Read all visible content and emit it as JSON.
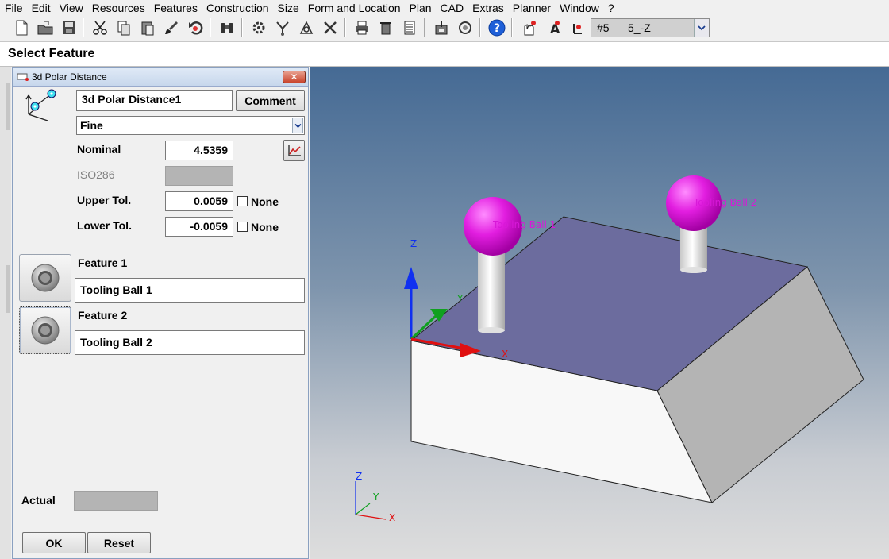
{
  "menu": [
    "File",
    "Edit",
    "View",
    "Resources",
    "Features",
    "Construction",
    "Size",
    "Form and Location",
    "Plan",
    "CAD",
    "Extras",
    "Planner",
    "Window",
    "?"
  ],
  "toolbar": {
    "icons": [
      "new-file-icon",
      "open-folder-icon",
      "save-icon",
      "cut-icon",
      "copy-icon",
      "paste-icon",
      "brush-icon",
      "undo-icon",
      "binoculars-icon",
      "probe-settings-icon",
      "stylus-icon",
      "coordinate-icon",
      "tools-icon",
      "print-icon",
      "delete-icon",
      "list-icon",
      "measure-icon",
      "refresh-icon",
      "help-icon",
      "touch-icon",
      "text-icon",
      "axis-icon"
    ],
    "combo_number": "#5",
    "combo_value": "5_-Z"
  },
  "status": {
    "title": "Select Feature"
  },
  "dialog": {
    "title": "3d Polar Distance",
    "close_label": "✕",
    "name_value": "3d Polar Distance1",
    "comment_label": "Comment",
    "mode_value": "Fine",
    "nominal_label": "Nominal",
    "nominal_value": "4.5359",
    "iso_label": "ISO286",
    "upper_label": "Upper Tol.",
    "upper_value": "0.0059",
    "lower_label": "Lower Tol.",
    "lower_value": "-0.0059",
    "none_label": "None",
    "feature1_label": "Feature 1",
    "feature1_value": "Tooling Ball 1",
    "feature2_label": "Feature 2",
    "feature2_value": "Tooling Ball 2",
    "actual_label": "Actual",
    "ok_label": "OK",
    "reset_label": "Reset"
  },
  "viewport": {
    "ball1_label": "Tooling Ball 1",
    "ball2_label": "Tooling Ball 2",
    "axis_x": "X",
    "axis_y": "Y",
    "axis_z": "Z",
    "ball_color": "#e21ee0",
    "top_face_color": "#6c6c9e"
  }
}
